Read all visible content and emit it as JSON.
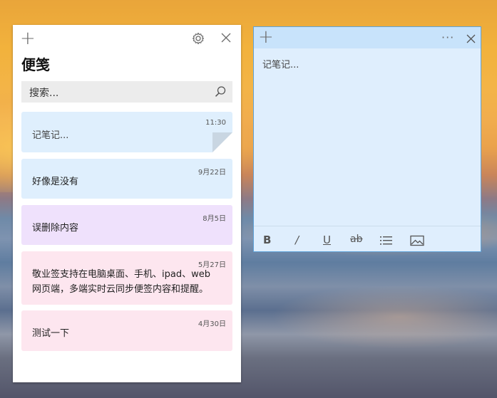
{
  "list_window": {
    "add_icon": "plus-icon",
    "settings_icon": "gear-icon",
    "close_icon": "close-icon",
    "title": "便笺",
    "search": {
      "placeholder": "搜索...",
      "icon": "search-icon"
    },
    "notes": [
      {
        "date": "11:30",
        "text": "记笔记...",
        "color": "#dfeffd"
      },
      {
        "date": "9月22日",
        "text": "好像是没有",
        "color": "#dfeffd"
      },
      {
        "date": "8月5日",
        "text": "误删除内容",
        "color": "#efe1fc"
      },
      {
        "date": "5月27日",
        "text_line1": "敬业签支持在电脑桌面、手机、ipad、web",
        "text_line2": "网页端，多端实时云同步便签内容和提醒。",
        "color": "#fde6ef"
      },
      {
        "date": "4月30日",
        "text": "测试一下",
        "color": "#fde6ef"
      }
    ]
  },
  "editor_window": {
    "add_icon": "plus-icon",
    "more_label": "···",
    "close_icon": "close-icon",
    "body_placeholder": "记笔记...",
    "toolbar": {
      "bold": "B",
      "italic": "/",
      "underline": "U",
      "strike": "ab",
      "list_icon": "bullet-list-icon",
      "image_icon": "image-icon"
    },
    "accent_color": "#c8e3fb"
  }
}
